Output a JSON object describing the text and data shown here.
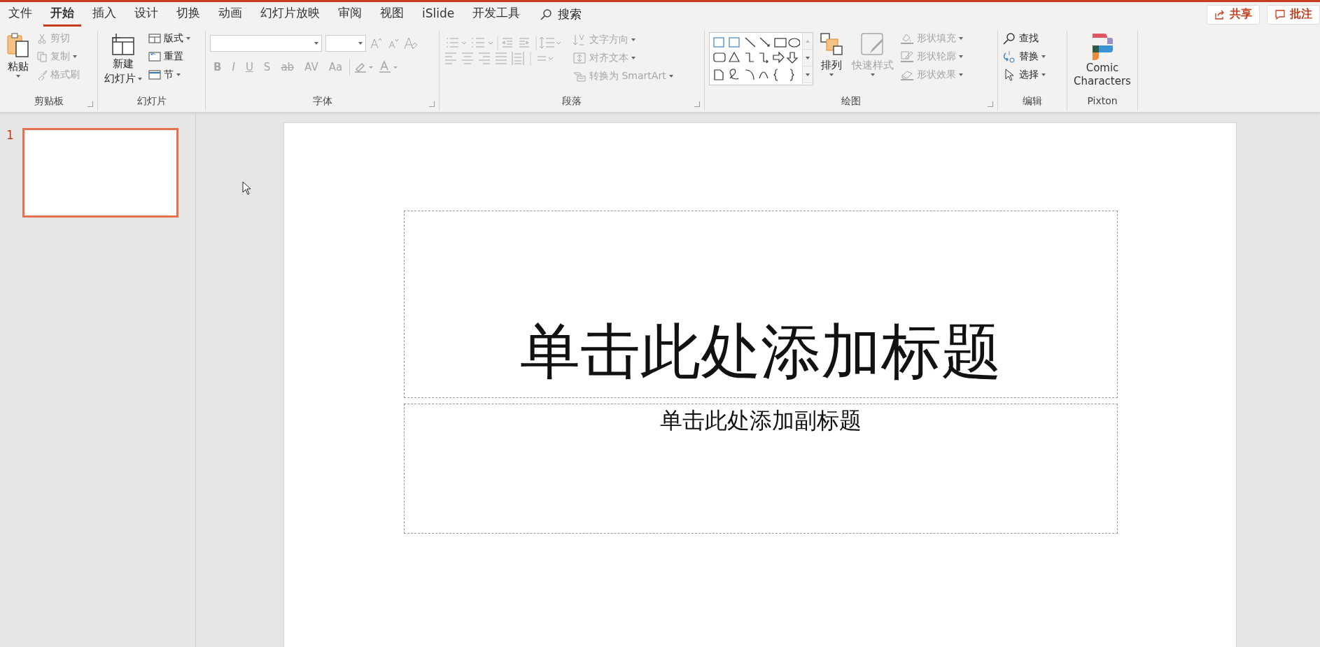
{
  "tabs": [
    {
      "label": "文件",
      "selected": false
    },
    {
      "label": "开始",
      "selected": true
    },
    {
      "label": "插入",
      "selected": false
    },
    {
      "label": "设计",
      "selected": false
    },
    {
      "label": "切换",
      "selected": false
    },
    {
      "label": "动画",
      "selected": false
    },
    {
      "label": "幻灯片放映",
      "selected": false
    },
    {
      "label": "审阅",
      "selected": false
    },
    {
      "label": "视图",
      "selected": false
    },
    {
      "label": "iSlide",
      "selected": false
    },
    {
      "label": "开发工具",
      "selected": false
    }
  ],
  "search": {
    "label": "搜索"
  },
  "actions": [
    "共享",
    "批注"
  ],
  "clipboard": {
    "title": "剪贴板",
    "paste": {
      "label": "粘贴",
      "disabled": false
    },
    "items": [
      {
        "label": "剪切",
        "disabled": true
      },
      {
        "label": "复制",
        "disabled": true
      },
      {
        "label": "格式刷",
        "disabled": true
      }
    ]
  },
  "slides": {
    "title": "幻灯片",
    "new_slide": {
      "lines": [
        "新建",
        "幻灯片"
      ]
    },
    "items": [
      {
        "label": "版式"
      },
      {
        "label": "重置"
      },
      {
        "label": "节"
      }
    ]
  },
  "font": {
    "title": "字体",
    "disabled": true,
    "format_buttons": [
      "B",
      "I",
      "U",
      "S",
      "ab",
      "AV",
      "Aa"
    ]
  },
  "paragraph": {
    "title": "段落",
    "disabled": true,
    "items": [
      "文字方向",
      "对齐文本",
      "转换为 SmartArt"
    ]
  },
  "drawing": {
    "title": "绘图",
    "arrange": {
      "label": "排列",
      "disabled": false
    },
    "quick_styles": {
      "label": "快速样式",
      "disabled": true
    },
    "items": [
      {
        "label": "形状填充",
        "disabled": true
      },
      {
        "label": "形状轮廓",
        "disabled": true
      },
      {
        "label": "形状效果",
        "disabled": true
      }
    ]
  },
  "editing": {
    "title": "编辑",
    "items": [
      "查找",
      "替换",
      "选择"
    ]
  },
  "pixton": {
    "title": "Pixton",
    "lines": [
      "Comic",
      "Characters"
    ]
  },
  "thumbnails": [
    {
      "number": "1",
      "selected": true
    }
  ],
  "slide": {
    "title_placeholder": "单击此处添加标题",
    "subtitle_placeholder": "单击此处添加副标题"
  }
}
